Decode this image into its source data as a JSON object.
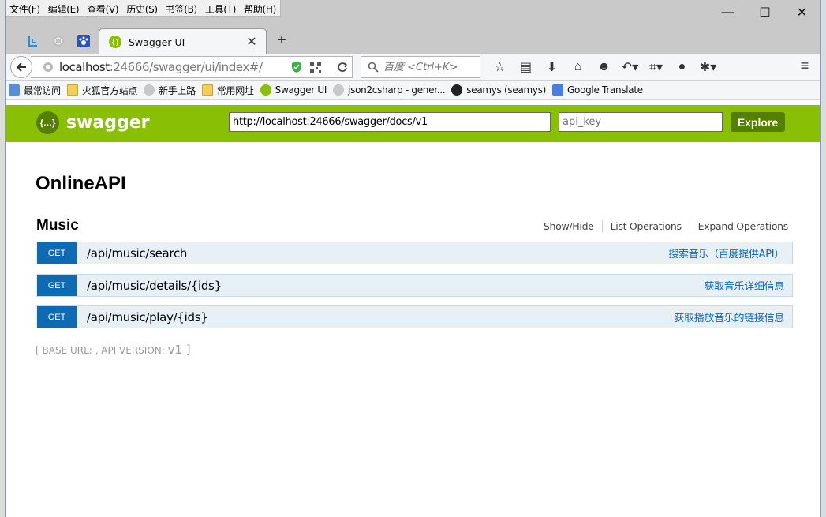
{
  "menu": [
    "文件(F)",
    "编辑(E)",
    "查看(V)",
    "历史(S)",
    "书签(B)",
    "工具(T)",
    "帮助(H)"
  ],
  "window_buttons": {
    "minimize": "—",
    "maximize": "☐",
    "close": "✕"
  },
  "tab": {
    "title": "Swagger UI",
    "close": "✕",
    "new_tab": "+"
  },
  "navbar": {
    "url_host": "localhost",
    "url_rest": ":24666/swagger/ui/index#/",
    "search_placeholder": "百度 <Ctrl+K>"
  },
  "bookmarks": [
    "最常访问",
    "火狐官方站点",
    "新手上路",
    "常用网址",
    "Swagger UI",
    "json2csharp - gener...",
    "seamys (seamys)",
    "Google Translate"
  ],
  "swagger": {
    "logo_text": "swagger",
    "logo_icon": "{…}",
    "url_value": "http://localhost:24666/swagger/docs/v1",
    "api_key_placeholder": "api_key",
    "explore_label": "Explore",
    "api_title": "OnlineAPI",
    "section": {
      "title": "Music",
      "links": [
        "Show/Hide",
        "List Operations",
        "Expand Operations"
      ]
    },
    "operations": [
      {
        "method": "GET",
        "path": "/api/music/search",
        "desc": "搜索音乐（百度提供API）"
      },
      {
        "method": "GET",
        "path": "/api/music/details/{ids}",
        "desc": "获取音乐详细信息"
      },
      {
        "method": "GET",
        "path": "/api/music/play/{ids}",
        "desc": "获取播放音乐的链接信息"
      }
    ],
    "base_url_prefix": "[ BASE URL: , API VERSION: ",
    "api_version": "v1",
    "base_url_suffix": " ]"
  },
  "colors": {
    "swagger_green": "#89bf04",
    "explore_green": "#547f00",
    "get_blue": "#0f6ab4",
    "op_bg": "#e7f0f7"
  }
}
